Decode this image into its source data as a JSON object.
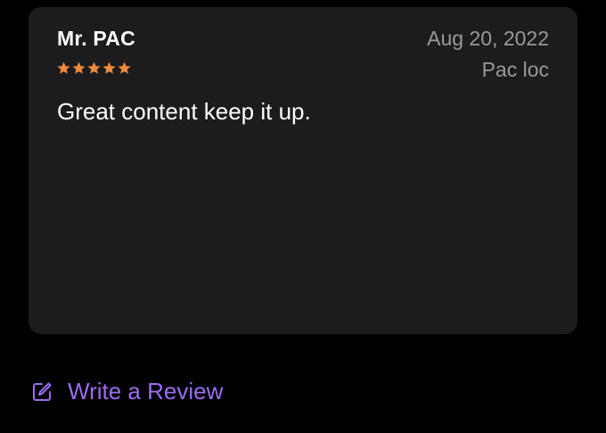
{
  "review": {
    "author": "Mr. PAC",
    "date": "Aug 20, 2022",
    "location": "Pac loc",
    "rating": 5,
    "rating_max": 5,
    "body": "Great content keep it up."
  },
  "actions": {
    "write_review_label": "Write a Review",
    "write_review_icon": "compose-icon"
  },
  "colors": {
    "background": "#000000",
    "card": "#1c1c1e",
    "star": "#f08a3c",
    "secondary_text": "#98989e",
    "accent": "#9b6cf0"
  }
}
